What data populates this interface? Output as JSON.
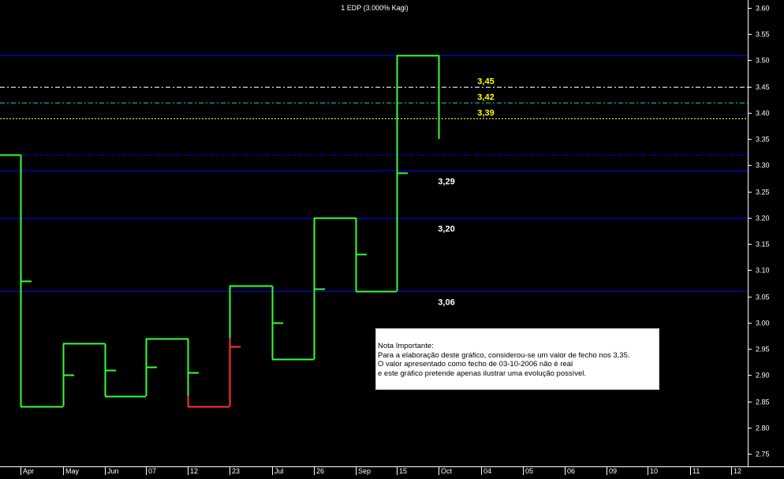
{
  "chart_data": {
    "type": "line",
    "title": "1 EDP (3.000% Kagi)",
    "ylim": [
      2.72,
      3.61
    ],
    "y_ticks": [
      "3.60",
      "3.55",
      "3.50",
      "3.45",
      "3.40",
      "3.35",
      "3.30",
      "3.25",
      "3.20",
      "3.15",
      "3.10",
      "3.05",
      "3.00",
      "2.95",
      "2.90",
      "2.85",
      "2.80",
      "2.75"
    ],
    "x_ticks": [
      "Apr",
      "May",
      "Jun",
      "07",
      "12",
      "23",
      "Jul",
      "26",
      "Sep",
      "15",
      "Oct",
      "04",
      "05",
      "06",
      "09",
      "10",
      "11",
      "12"
    ],
    "kagi": [
      {
        "type": "h",
        "y": 3.32,
        "x1": 0,
        "x2": 1
      },
      {
        "type": "v",
        "y1": 3.32,
        "y2": 2.84,
        "x": 1,
        "color": "green"
      },
      {
        "type": "tick",
        "y": 3.08,
        "x": 1,
        "side": "right"
      },
      {
        "type": "h",
        "y": 2.84,
        "x1": 1,
        "x2": 2,
        "color": "green"
      },
      {
        "type": "v",
        "y1": 2.84,
        "y2": 2.96,
        "x": 2,
        "color": "green"
      },
      {
        "type": "tick",
        "y": 2.9,
        "x": 2,
        "side": "right"
      },
      {
        "type": "h",
        "y": 2.96,
        "x1": 2,
        "x2": 3,
        "color": "green"
      },
      {
        "type": "v",
        "y1": 2.96,
        "y2": 2.86,
        "x": 3,
        "color": "green"
      },
      {
        "type": "tick",
        "y": 2.91,
        "x": 3,
        "side": "right"
      },
      {
        "type": "h",
        "y": 2.86,
        "x1": 3,
        "x2": 4,
        "color": "green"
      },
      {
        "type": "v",
        "y1": 2.86,
        "y2": 2.97,
        "x": 4,
        "color": "green"
      },
      {
        "type": "tick",
        "y": 2.915,
        "x": 4,
        "side": "right"
      },
      {
        "type": "h",
        "y": 2.97,
        "x1": 4,
        "x2": 5,
        "color": "green"
      },
      {
        "type": "v",
        "y1": 2.97,
        "y2": 2.86,
        "x": 5,
        "color": "green"
      },
      {
        "type": "tick",
        "y": 2.905,
        "x": 5,
        "side": "right"
      },
      {
        "type": "v",
        "y1": 2.86,
        "y2": 2.84,
        "x": 5,
        "color": "red"
      },
      {
        "type": "h",
        "y": 2.84,
        "x1": 5,
        "x2": 6,
        "color": "red"
      },
      {
        "type": "v",
        "y1": 2.84,
        "y2": 2.97,
        "x": 6,
        "color": "red"
      },
      {
        "type": "tick",
        "y": 2.955,
        "x": 6,
        "side": "right",
        "color": "red"
      },
      {
        "type": "v",
        "y1": 2.97,
        "y2": 3.07,
        "x": 6,
        "color": "green"
      },
      {
        "type": "h",
        "y": 3.07,
        "x1": 6,
        "x2": 7,
        "color": "green"
      },
      {
        "type": "v",
        "y1": 3.07,
        "y2": 2.93,
        "x": 7,
        "color": "green"
      },
      {
        "type": "tick",
        "y": 3.0,
        "x": 7,
        "side": "right"
      },
      {
        "type": "h",
        "y": 2.93,
        "x1": 7,
        "x2": 8,
        "color": "green"
      },
      {
        "type": "v",
        "y1": 2.93,
        "y2": 3.2,
        "x": 8,
        "color": "green"
      },
      {
        "type": "tick",
        "y": 3.065,
        "x": 8,
        "side": "right"
      },
      {
        "type": "h",
        "y": 3.2,
        "x1": 8,
        "x2": 9,
        "color": "green"
      },
      {
        "type": "v",
        "y1": 3.2,
        "y2": 3.06,
        "x": 9,
        "color": "green"
      },
      {
        "type": "tick",
        "y": 3.13,
        "x": 9,
        "side": "right"
      },
      {
        "type": "h",
        "y": 3.06,
        "x1": 9,
        "x2": 10,
        "color": "green"
      },
      {
        "type": "v",
        "y1": 3.06,
        "y2": 3.51,
        "x": 10,
        "color": "green"
      },
      {
        "type": "tick",
        "y": 3.285,
        "x": 10,
        "side": "right"
      },
      {
        "type": "h",
        "y": 3.51,
        "x1": 10,
        "x2": 11,
        "color": "green"
      },
      {
        "type": "v",
        "y1": 3.51,
        "y2": 3.35,
        "x": 11,
        "color": "green"
      }
    ],
    "levels": [
      {
        "value": 3.51,
        "style": "solid",
        "color": "#0000ff"
      },
      {
        "value": 3.45,
        "style": "dashdot",
        "color": "#ffffff",
        "label": "3,45",
        "label_color": "#ffff00"
      },
      {
        "value": 3.42,
        "style": "dashdot",
        "color": "#00cccc",
        "label": "3,42",
        "label_color": "#ffff00"
      },
      {
        "value": 3.39,
        "style": "dotted",
        "color": "#ffff00",
        "label": "3,39",
        "label_color": "#ffff00"
      },
      {
        "value": 3.32,
        "style": "dashdot",
        "color": "#0000ff"
      },
      {
        "value": 3.29,
        "style": "solid",
        "color": "#0000ff",
        "label": "3,29",
        "label_color": "#ffffff"
      },
      {
        "value": 3.2,
        "style": "solid",
        "color": "#0000ff",
        "label": "3,20",
        "label_color": "#ffffff"
      },
      {
        "value": 3.06,
        "style": "solid",
        "color": "#0000ff",
        "label": "3,06",
        "label_color": "#ffffff"
      }
    ],
    "colors": {
      "up": "#33ff33",
      "down": "#ff3333",
      "axis": "#ffffff"
    }
  },
  "note": {
    "lines": [
      "Nota Importante:",
      "Para a elaboração deste gráfico, considerou-se um valor de fecho nos 3,35.",
      "O valor apresentado como fecho de 03-10-2006 não é real",
      "e este gráfico pretende apenas ilustrar uma evolução possível."
    ]
  }
}
